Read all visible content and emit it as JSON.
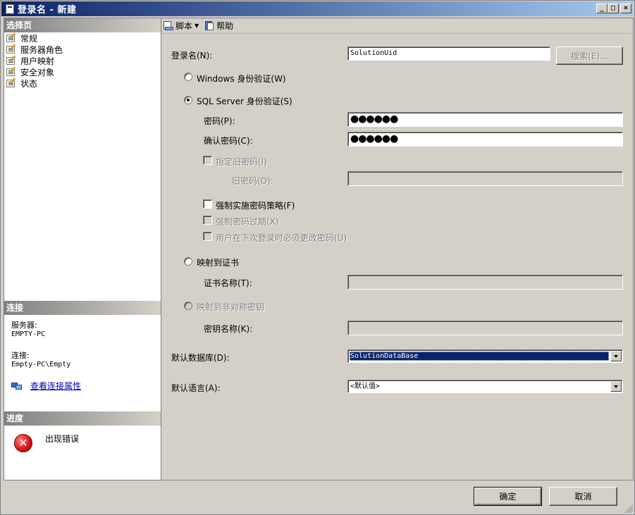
{
  "window": {
    "title": "登录名 - 新建",
    "controls": {
      "minimize": "_",
      "maximize": "□",
      "close": "×"
    }
  },
  "left": {
    "select_page_header": "选择页",
    "pages": [
      {
        "label": "常规",
        "icon": "page-icon"
      },
      {
        "label": "服务器角色",
        "icon": "page-icon"
      },
      {
        "label": "用户映射",
        "icon": "page-icon"
      },
      {
        "label": "安全对象",
        "icon": "page-icon"
      },
      {
        "label": "状态",
        "icon": "page-icon"
      }
    ],
    "connection_header": "连接",
    "server_label": "服务器:",
    "server_value": "EMPTY-PC",
    "connection_label": "连接:",
    "connection_value": "Empty-PC\\Empty",
    "view_connection_link": "查看连接属性",
    "progress_header": "进度",
    "progress_status": "出现错误"
  },
  "toolbar": {
    "script_label": "脚本",
    "help_label": "帮助"
  },
  "form": {
    "login_name_label": "登录名(N):",
    "login_name_value": "SolutionUid",
    "search_button": "搜索(E)...",
    "windows_auth_label": "Windows 身份验证(W)",
    "sql_auth_label": "SQL Server 身份验证(S)",
    "password_label": "密码(P):",
    "password_value": "●●●●●●",
    "confirm_password_label": "确认密码(C):",
    "confirm_password_value": "●●●●●●",
    "specify_old_password_label": "指定旧密码(I)",
    "old_password_label": "旧密码(O):",
    "enforce_policy_label": "强制实施密码策略(F)",
    "enforce_expiration_label": "强制密码过期(X)",
    "must_change_label": "用户在下次登录时必须更改密码(U)",
    "map_certificate_label": "映射到证书",
    "certificate_name_label": "证书名称(T):",
    "map_asymmetric_key_label": "映射到非对称密钥",
    "key_name_label": "密钥名称(K):",
    "default_database_label": "默认数据库(D):",
    "default_database_value": "SolutionDataBase",
    "default_language_label": "默认语言(A):",
    "default_language_value": "<默认值>"
  },
  "buttons": {
    "ok": "确定",
    "cancel": "取消"
  }
}
